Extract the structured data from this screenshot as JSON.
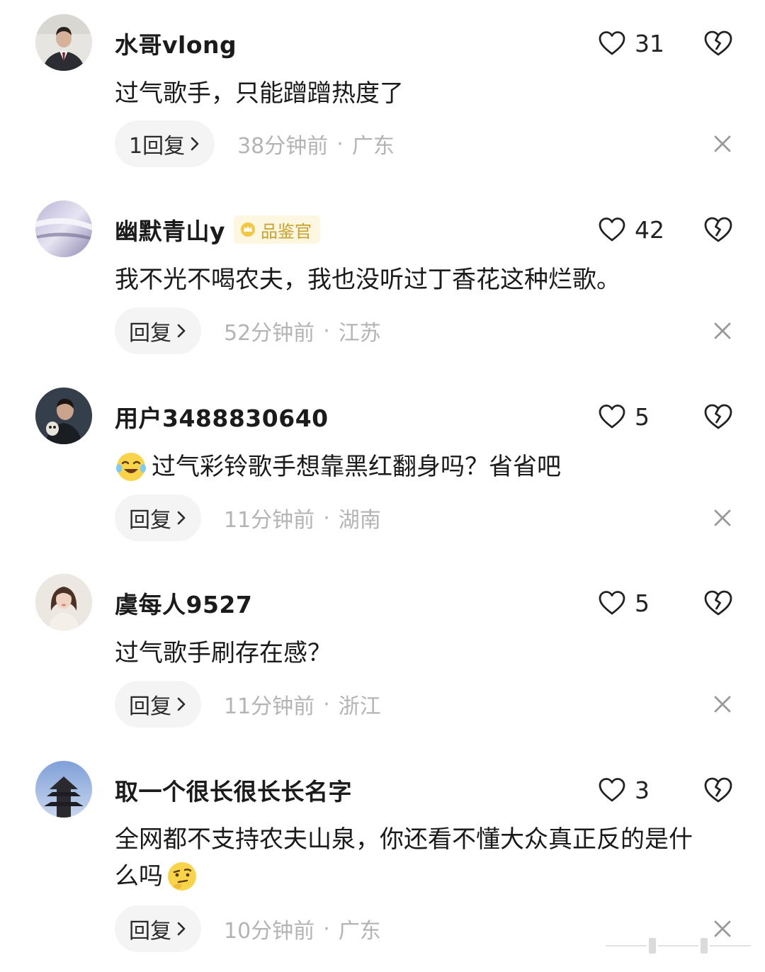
{
  "comments": [
    {
      "username": "水哥vlong",
      "likes": "31",
      "text": "过气歌手，只能蹭蹭热度了",
      "reply_label": "1回复",
      "time": "38分钟前",
      "separator": "·",
      "location": "广东"
    },
    {
      "username": "幽默青山y",
      "badge": "品鉴官",
      "likes": "42",
      "text": "我不光不喝农夫，我也没听过丁香花这种烂歌。",
      "reply_label": "回复",
      "time": "52分钟前",
      "separator": "·",
      "location": "江苏"
    },
    {
      "username": "用户3488830640",
      "likes": "5",
      "text": "过气彩铃歌手想靠黑红翻身吗？省省吧",
      "emoji_before": "crying-laughing-emoji",
      "reply_label": "回复",
      "time": "11分钟前",
      "separator": "·",
      "location": "湖南"
    },
    {
      "username": "虞每人9527",
      "likes": "5",
      "text": "过气歌手刷存在感？",
      "reply_label": "回复",
      "time": "11分钟前",
      "separator": "·",
      "location": "浙江"
    },
    {
      "username": "取一个很长很长长名字",
      "likes": "3",
      "text_line1": "全网都不支持农夫山泉，你还看不懂大众真正反的是什",
      "text_line2": "么吗",
      "emoji_after": "thinking-face-emoji",
      "reply_label": "回复",
      "time": "10分钟前",
      "separator": "·",
      "location": "广东"
    }
  ],
  "icons": {
    "like": "heart-outline-icon",
    "dislike": "broken-heart-icon",
    "close": "close-x-icon",
    "chevron": "chevron-right-icon",
    "badge": "crown-badge-icon"
  },
  "colors": {
    "badge_text": "#c8a22c",
    "badge_bg": "#fdf6e0",
    "meta_text": "#b4b4b4",
    "pill_bg": "#f4f4f4"
  }
}
